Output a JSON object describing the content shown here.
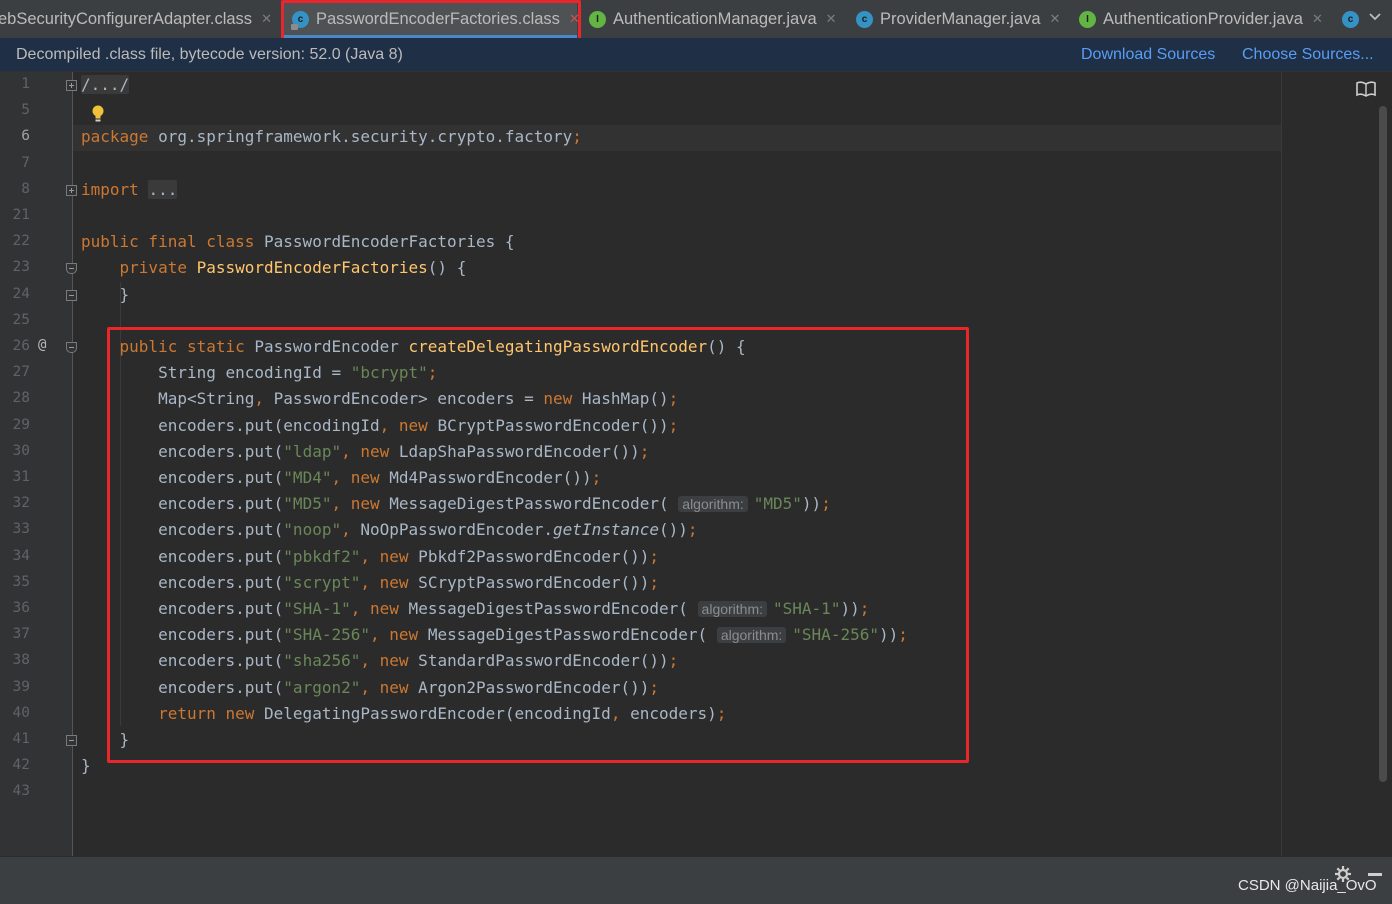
{
  "tabs": [
    {
      "label": "ebSecurityConfigurerAdapter.class",
      "icon": "class-icon"
    },
    {
      "label": "PasswordEncoderFactories.class",
      "icon": "class-icon",
      "active": true
    },
    {
      "label": "AuthenticationManager.java",
      "icon": "interface-icon"
    },
    {
      "label": "ProviderManager.java",
      "icon": "class-icon"
    },
    {
      "label": "AuthenticationProvider.java",
      "icon": "interface-icon"
    }
  ],
  "notice": {
    "text": "Decompiled .class file, bytecode version: 52.0 (Java 8)",
    "download_sources": "Download Sources",
    "choose_sources": "Choose Sources..."
  },
  "editor": {
    "current_line": "6",
    "line_numbers": [
      "1",
      "5",
      "6",
      "7",
      "8",
      "21",
      "22",
      "23",
      "24",
      "25",
      "26",
      "27",
      "28",
      "29",
      "30",
      "31",
      "32",
      "33",
      "34",
      "35",
      "36",
      "37",
      "38",
      "39",
      "40",
      "41",
      "42",
      "43"
    ],
    "lines": [
      {
        "parts": [
          {
            "t": "/.../",
            "c": "foldtext"
          }
        ]
      },
      {
        "parts": []
      },
      {
        "parts": [
          {
            "t": "package",
            "c": "kw"
          },
          {
            "t": " org.springframework.security.crypto.factory"
          },
          {
            "t": ";",
            "c": "kw"
          }
        ]
      },
      {
        "parts": []
      },
      {
        "parts": [
          {
            "t": "import",
            "c": "kw"
          },
          {
            "t": " "
          },
          {
            "t": "...",
            "c": "foldtext"
          }
        ]
      },
      {
        "parts": []
      },
      {
        "parts": [
          {
            "t": "public final class",
            "c": "kw"
          },
          {
            "t": " PasswordEncoderFactories {"
          }
        ]
      },
      {
        "parts": [
          {
            "t": "    "
          },
          {
            "t": "private",
            "c": "kw"
          },
          {
            "t": " "
          },
          {
            "t": "PasswordEncoderFactories",
            "c": "fn"
          },
          {
            "t": "() {"
          }
        ]
      },
      {
        "parts": [
          {
            "t": "    }"
          }
        ]
      },
      {
        "parts": []
      },
      {
        "parts": [
          {
            "t": "    "
          },
          {
            "t": "public static",
            "c": "kw"
          },
          {
            "t": " PasswordEncoder "
          },
          {
            "t": "createDelegatingPasswordEncoder",
            "c": "fn"
          },
          {
            "t": "() {"
          }
        ]
      },
      {
        "parts": [
          {
            "t": "        String encodingId = "
          },
          {
            "t": "\"bcrypt\"",
            "c": "str"
          },
          {
            "t": ";",
            "c": "kw"
          }
        ]
      },
      {
        "parts": [
          {
            "t": "        Map<String"
          },
          {
            "t": ",",
            "c": "kw"
          },
          {
            "t": " PasswordEncoder> encoders = "
          },
          {
            "t": "new",
            "c": "kw"
          },
          {
            "t": " HashMap()"
          },
          {
            "t": ";",
            "c": "kw"
          }
        ]
      },
      {
        "parts": [
          {
            "t": "        encoders.put(encodingId"
          },
          {
            "t": ",",
            "c": "kw"
          },
          {
            "t": " "
          },
          {
            "t": "new",
            "c": "kw"
          },
          {
            "t": " BCryptPasswordEncoder())"
          },
          {
            "t": ";",
            "c": "kw"
          }
        ]
      },
      {
        "parts": [
          {
            "t": "        encoders.put("
          },
          {
            "t": "\"ldap\"",
            "c": "str"
          },
          {
            "t": ",",
            "c": "kw"
          },
          {
            "t": " "
          },
          {
            "t": "new",
            "c": "kw"
          },
          {
            "t": " LdapShaPasswordEncoder())"
          },
          {
            "t": ";",
            "c": "kw"
          }
        ]
      },
      {
        "parts": [
          {
            "t": "        encoders.put("
          },
          {
            "t": "\"MD4\"",
            "c": "str"
          },
          {
            "t": ",",
            "c": "kw"
          },
          {
            "t": " "
          },
          {
            "t": "new",
            "c": "kw"
          },
          {
            "t": " Md4PasswordEncoder())"
          },
          {
            "t": ";",
            "c": "kw"
          }
        ]
      },
      {
        "parts": [
          {
            "t": "        encoders.put("
          },
          {
            "t": "\"MD5\"",
            "c": "str"
          },
          {
            "t": ",",
            "c": "kw"
          },
          {
            "t": " "
          },
          {
            "t": "new",
            "c": "kw"
          },
          {
            "t": " MessageDigestPasswordEncoder( "
          },
          {
            "t": "algorithm:",
            "c": "hint"
          },
          {
            "t": "\"MD5\"",
            "c": "str"
          },
          {
            "t": "))"
          },
          {
            "t": ";",
            "c": "kw"
          }
        ]
      },
      {
        "parts": [
          {
            "t": "        encoders.put("
          },
          {
            "t": "\"noop\"",
            "c": "str"
          },
          {
            "t": ",",
            "c": "kw"
          },
          {
            "t": " NoOpPasswordEncoder."
          },
          {
            "t": "getInstance",
            "c": "it"
          },
          {
            "t": "())"
          },
          {
            "t": ";",
            "c": "kw"
          }
        ]
      },
      {
        "parts": [
          {
            "t": "        encoders.put("
          },
          {
            "t": "\"pbkdf2\"",
            "c": "str"
          },
          {
            "t": ",",
            "c": "kw"
          },
          {
            "t": " "
          },
          {
            "t": "new",
            "c": "kw"
          },
          {
            "t": " Pbkdf2PasswordEncoder())"
          },
          {
            "t": ";",
            "c": "kw"
          }
        ]
      },
      {
        "parts": [
          {
            "t": "        encoders.put("
          },
          {
            "t": "\"scrypt\"",
            "c": "str"
          },
          {
            "t": ",",
            "c": "kw"
          },
          {
            "t": " "
          },
          {
            "t": "new",
            "c": "kw"
          },
          {
            "t": " SCryptPasswordEncoder())"
          },
          {
            "t": ";",
            "c": "kw"
          }
        ]
      },
      {
        "parts": [
          {
            "t": "        encoders.put("
          },
          {
            "t": "\"SHA-1\"",
            "c": "str"
          },
          {
            "t": ",",
            "c": "kw"
          },
          {
            "t": " "
          },
          {
            "t": "new",
            "c": "kw"
          },
          {
            "t": " MessageDigestPasswordEncoder( "
          },
          {
            "t": "algorithm:",
            "c": "hint"
          },
          {
            "t": "\"SHA-1\"",
            "c": "str"
          },
          {
            "t": "))"
          },
          {
            "t": ";",
            "c": "kw"
          }
        ]
      },
      {
        "parts": [
          {
            "t": "        encoders.put("
          },
          {
            "t": "\"SHA-256\"",
            "c": "str"
          },
          {
            "t": ",",
            "c": "kw"
          },
          {
            "t": " "
          },
          {
            "t": "new",
            "c": "kw"
          },
          {
            "t": " MessageDigestPasswordEncoder( "
          },
          {
            "t": "algorithm:",
            "c": "hint"
          },
          {
            "t": "\"SHA-256\"",
            "c": "str"
          },
          {
            "t": "))"
          },
          {
            "t": ";",
            "c": "kw"
          }
        ]
      },
      {
        "parts": [
          {
            "t": "        encoders.put("
          },
          {
            "t": "\"sha256\"",
            "c": "str"
          },
          {
            "t": ",",
            "c": "kw"
          },
          {
            "t": " "
          },
          {
            "t": "new",
            "c": "kw"
          },
          {
            "t": " StandardPasswordEncoder())"
          },
          {
            "t": ";",
            "c": "kw"
          }
        ]
      },
      {
        "parts": [
          {
            "t": "        encoders.put("
          },
          {
            "t": "\"argon2\"",
            "c": "str"
          },
          {
            "t": ",",
            "c": "kw"
          },
          {
            "t": " "
          },
          {
            "t": "new",
            "c": "kw"
          },
          {
            "t": " Argon2PasswordEncoder())"
          },
          {
            "t": ";",
            "c": "kw"
          }
        ]
      },
      {
        "parts": [
          {
            "t": "        "
          },
          {
            "t": "return new",
            "c": "kw"
          },
          {
            "t": " DelegatingPasswordEncoder(encodingId"
          },
          {
            "t": ",",
            "c": "kw"
          },
          {
            "t": " encoders)"
          },
          {
            "t": ";",
            "c": "kw"
          }
        ]
      },
      {
        "parts": [
          {
            "t": "    }"
          }
        ]
      },
      {
        "parts": [
          {
            "t": "}"
          }
        ]
      },
      {
        "parts": []
      }
    ]
  },
  "gutter_marker": "@",
  "watermark": "CSDN @Naijia_OvO",
  "colors": {
    "keyword": "#cc7832",
    "string": "#6a8759",
    "method": "#ffc66d",
    "text": "#a9b7c6",
    "annotation_box": "#e8262b",
    "link": "#589df6"
  }
}
